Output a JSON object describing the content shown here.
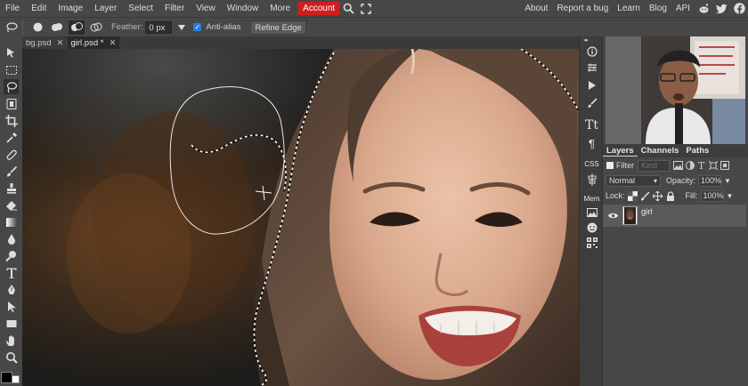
{
  "menubar": {
    "items": [
      "File",
      "Edit",
      "Image",
      "Layer",
      "Select",
      "Filter",
      "View",
      "Window",
      "More"
    ],
    "account_label": "Account",
    "right_links": [
      "About",
      "Report a bug",
      "Learn",
      "Blog",
      "API"
    ],
    "icons": [
      "search-icon",
      "fullscreen-icon",
      "reddit-icon",
      "twitter-icon",
      "facebook-icon"
    ],
    "account_color": "#d01e1e"
  },
  "options": {
    "feather_label": "Feather:",
    "feather_value": "0 px",
    "antialias_label": "Anti-alias",
    "antialias_checked": true,
    "refine_edge_label": "Refine Edge"
  },
  "tabs": [
    {
      "label": "bg.psd",
      "active": false
    },
    {
      "label": "girl.psd *",
      "active": true
    }
  ],
  "strip": {
    "collapse": "◂▸",
    "css_label": "CSS",
    "mem_label": "Mem"
  },
  "layers_panel": {
    "tabs": [
      "Layers",
      "Channels",
      "Paths"
    ],
    "filter_label": "Filter",
    "kind_placeholder": "Kind",
    "blend_mode": "Normal",
    "opacity_label": "Opacity:",
    "opacity_value": "100%",
    "lock_label": "Lock:",
    "fill_label": "Fill:",
    "fill_value": "100%",
    "layers": [
      {
        "name": "girl",
        "visible": true
      }
    ]
  },
  "colors": {
    "accent": "#2a7ae0",
    "panel": "#474747",
    "dark": "#2b2b2b"
  }
}
